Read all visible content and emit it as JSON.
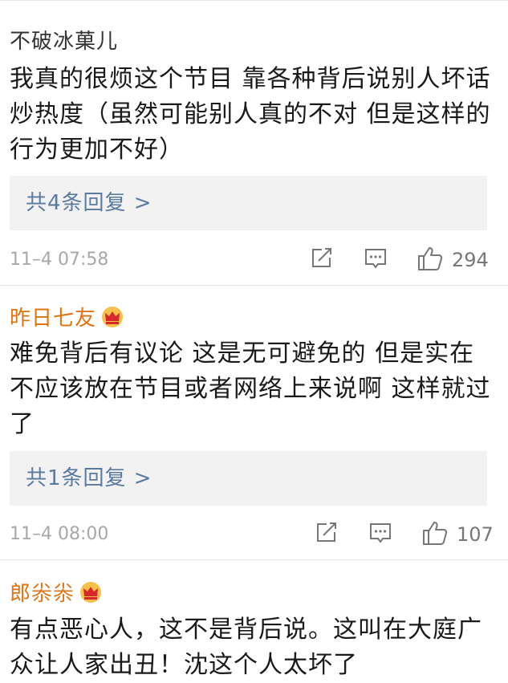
{
  "comments": [
    {
      "username": "不破冰菓儿",
      "vip": false,
      "content": "我真的很烦这个节目 靠各种背后说别人坏话炒热度（虽然可能别人真的不对 但是这样的行为更加不好）",
      "replies_label": "共4条回复 >",
      "time": "11–4 07:58",
      "likes": "294"
    },
    {
      "username": "昨日七友",
      "vip": true,
      "content": "难免背后有议论 这是无可避免的 但是实在不应该放在节目或者网络上来说啊 这样就过了",
      "replies_label": "共1条回复 >",
      "time": "11–4 08:00",
      "likes": "107"
    },
    {
      "username": "郎尜尜",
      "vip": true,
      "content": "有点恶心人，这不是背后说。这叫在大庭广众让人家出丑！沈这个人太坏了"
    }
  ],
  "icons": {
    "share": "share-edit-icon",
    "comment": "comment-icon",
    "like": "thumbs-up-icon",
    "vip": "crown-badge-icon"
  },
  "colors": {
    "vip_name": "#e0730f",
    "reply_link": "#5a7aa0",
    "meta_text": "#a8a8a8",
    "reply_bg": "#f2f2f2"
  }
}
